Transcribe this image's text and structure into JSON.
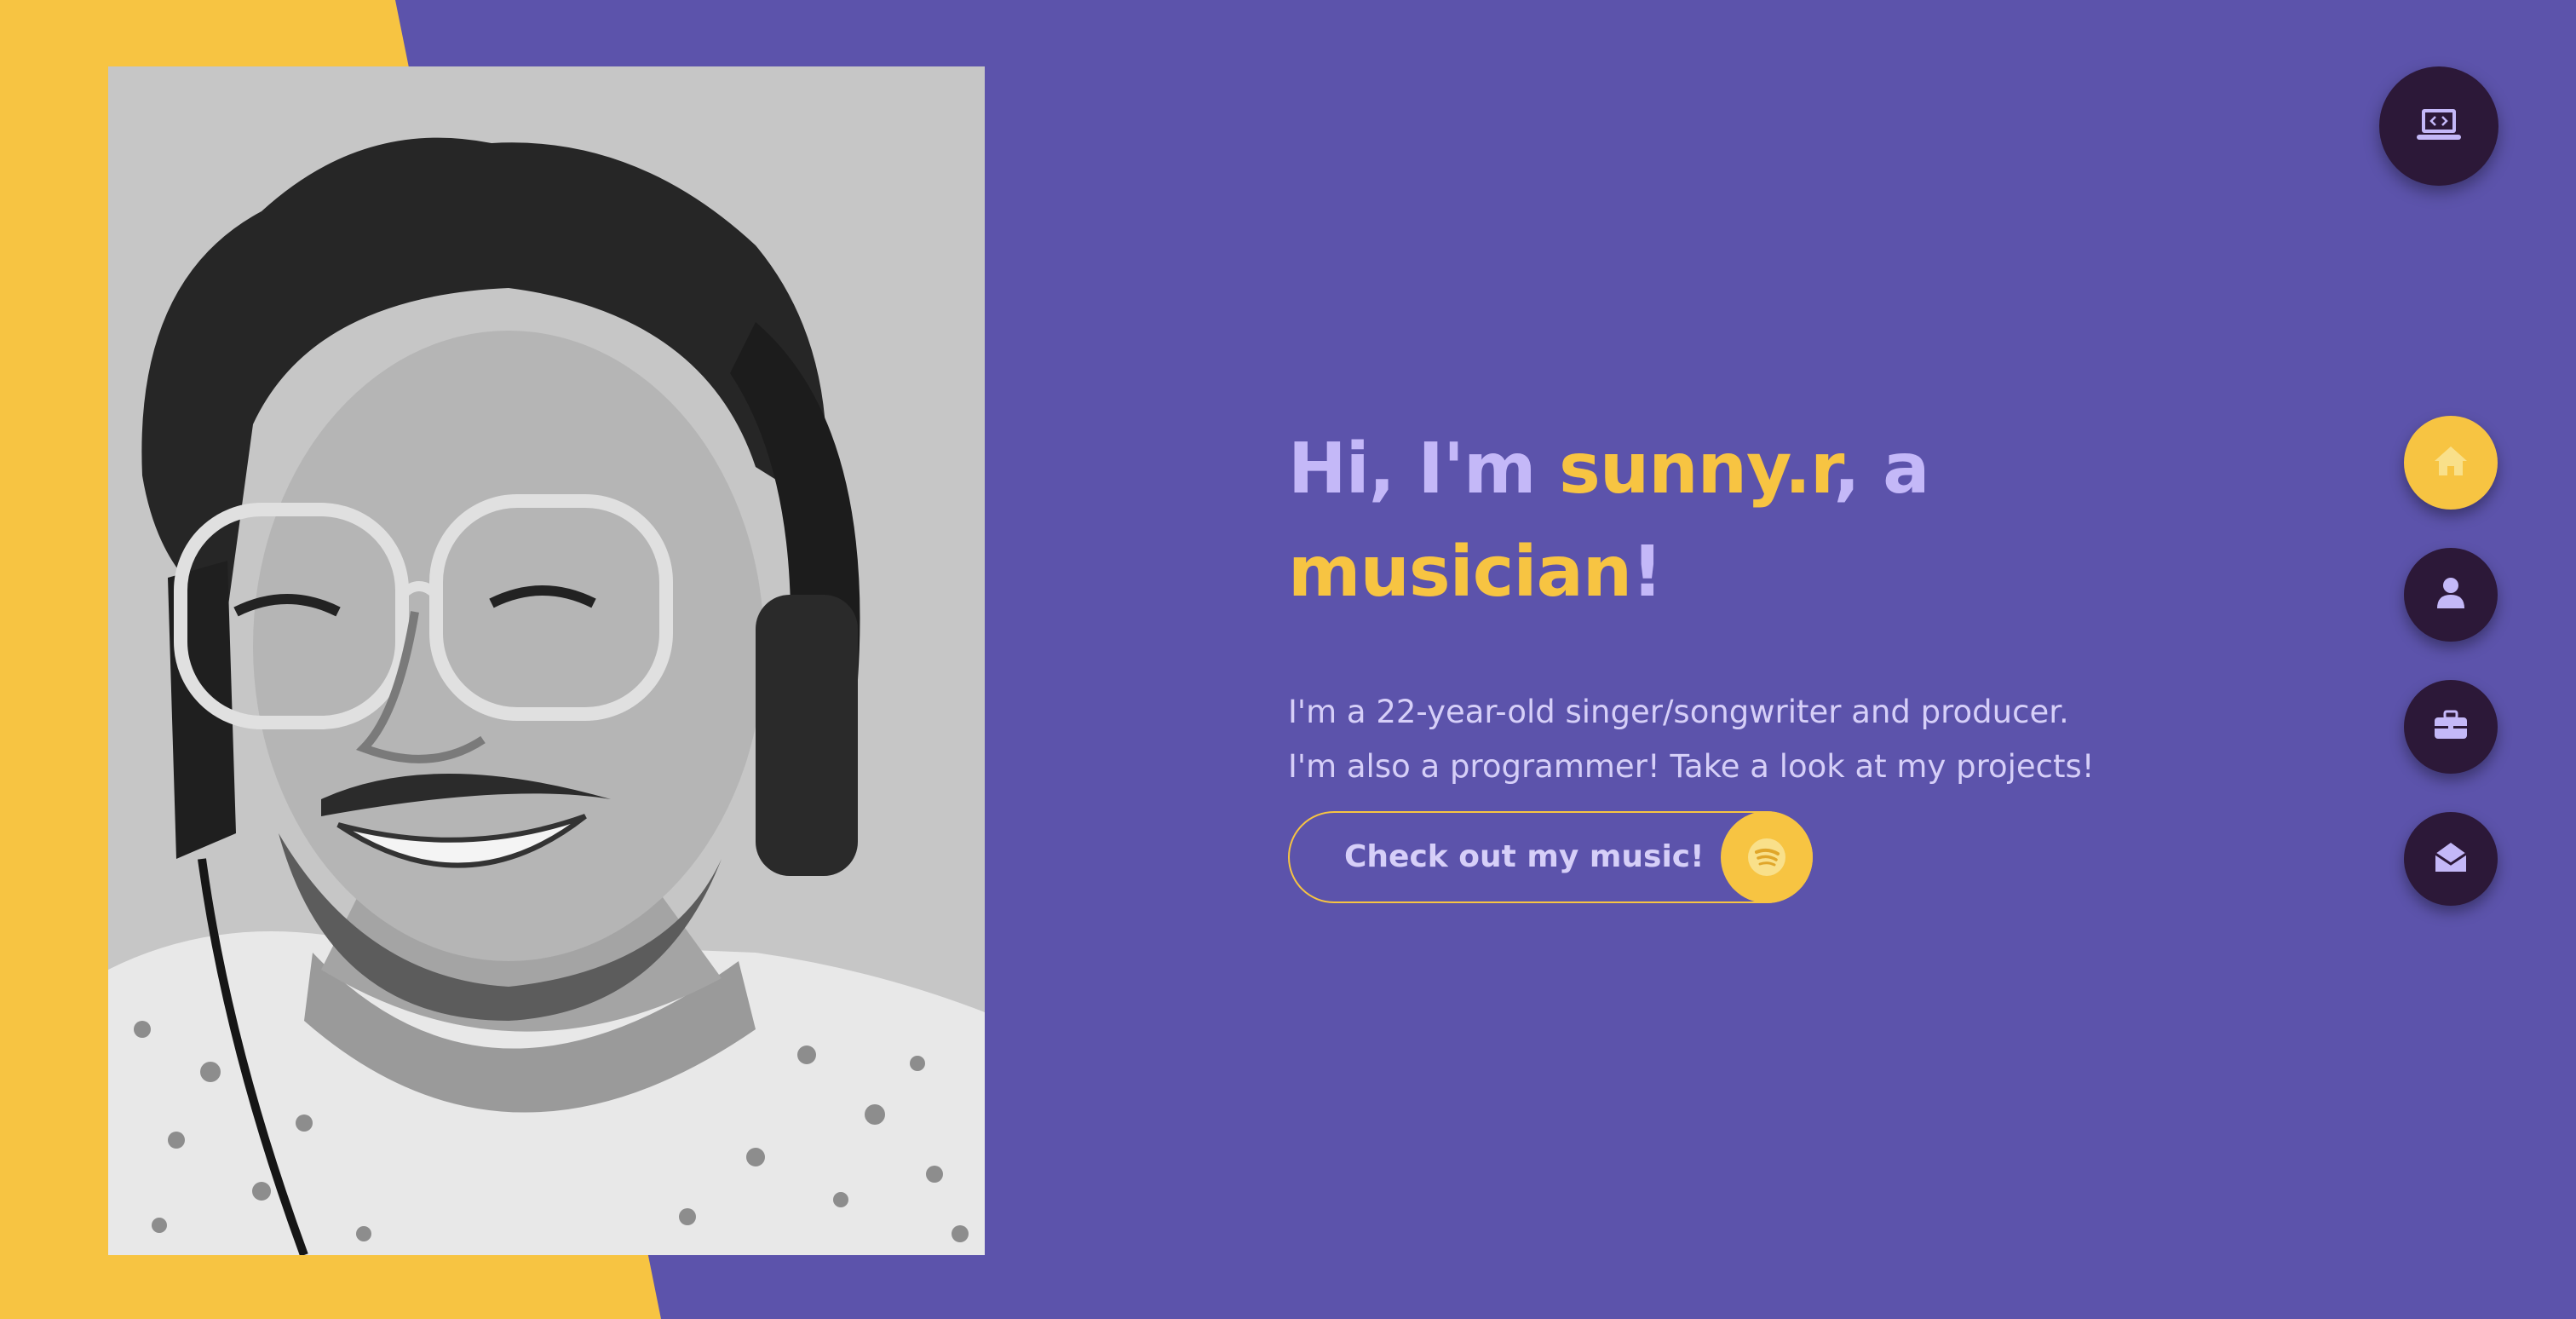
{
  "colors": {
    "background": "#5c53ab",
    "accent": "#f7c442",
    "headline": "#c4b8f8",
    "body_text": "#d6cff8",
    "nav_dark": "#2c1838"
  },
  "top_fab": {
    "icon": "laptop-code-icon"
  },
  "hero": {
    "headline_prefix": "Hi, I'm ",
    "headline_name": "sunny.r",
    "headline_mid": ", a",
    "headline_role": "musician",
    "headline_end": "!",
    "intro_line1": "I'm a 22-year-old singer/songwriter and producer.",
    "intro_line2": "I'm also a programmer! Take a look at my projects!",
    "cta_label": "Check out my music!",
    "cta_icon": "spotify-icon"
  },
  "photo": {
    "description_icon": "portrait-photo"
  },
  "side_nav": {
    "items": [
      {
        "icon": "home-icon",
        "active": true
      },
      {
        "icon": "user-icon",
        "active": false
      },
      {
        "icon": "briefcase-icon",
        "active": false
      },
      {
        "icon": "envelope-open-icon",
        "active": false
      }
    ]
  }
}
